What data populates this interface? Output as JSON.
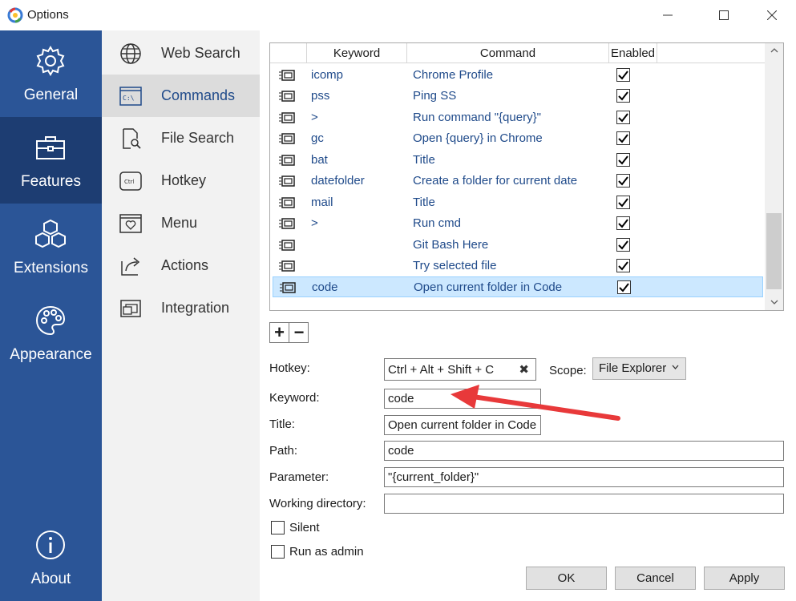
{
  "window": {
    "title": "Options"
  },
  "leftnav": {
    "items": [
      {
        "label": "General",
        "icon": "gear-icon"
      },
      {
        "label": "Features",
        "icon": "toolbox-icon"
      },
      {
        "label": "Extensions",
        "icon": "cubes-icon"
      },
      {
        "label": "Appearance",
        "icon": "palette-icon"
      },
      {
        "label": "About",
        "icon": "info-icon"
      }
    ]
  },
  "subnav": {
    "items": [
      {
        "label": "Web Search",
        "icon": "globe-icon"
      },
      {
        "label": "Commands",
        "icon": "terminal-icon"
      },
      {
        "label": "File Search",
        "icon": "file-search-icon"
      },
      {
        "label": "Hotkey",
        "icon": "ctrl-key-icon"
      },
      {
        "label": "Menu",
        "icon": "menu-icon"
      },
      {
        "label": "Actions",
        "icon": "share-arrow-icon"
      },
      {
        "label": "Integration",
        "icon": "window-icon"
      }
    ]
  },
  "grid": {
    "headers": {
      "keyword": "Keyword",
      "command": "Command",
      "enabled": "Enabled"
    },
    "rows": [
      {
        "keyword": "icomp",
        "command": "Chrome Profile",
        "enabled": true
      },
      {
        "keyword": "pss",
        "command": "Ping SS",
        "enabled": true
      },
      {
        "keyword": ">",
        "command": "Run command \"{query}\"",
        "enabled": true
      },
      {
        "keyword": "gc",
        "command": "Open {query} in Chrome",
        "enabled": true
      },
      {
        "keyword": "bat",
        "command": "Title",
        "enabled": true
      },
      {
        "keyword": "datefolder",
        "command": "Create a folder for current date",
        "enabled": true
      },
      {
        "keyword": "mail",
        "command": "Title",
        "enabled": true
      },
      {
        "keyword": ">",
        "command": "Run cmd",
        "enabled": true
      },
      {
        "keyword": "",
        "command": "Git Bash Here",
        "enabled": true
      },
      {
        "keyword": "",
        "command": "Try selected file",
        "enabled": true
      },
      {
        "keyword": "code",
        "command": "Open current folder in Code",
        "enabled": true,
        "selected": true
      }
    ]
  },
  "form": {
    "add_label": "+",
    "remove_label": "−",
    "hotkey_label": "Hotkey:",
    "hotkey_value": "Ctrl + Alt + Shift + C",
    "hotkey_clear": "✖",
    "scope_label": "Scope:",
    "scope_value": "File Explorer",
    "keyword_label": "Keyword:",
    "keyword_value": "code",
    "title_label": "Title:",
    "title_value": "Open current folder in Code",
    "path_label": "Path:",
    "path_value": "code",
    "parameter_label": "Parameter:",
    "parameter_value": "\"{current_folder}\"",
    "workdir_label": "Working directory:",
    "workdir_value": "",
    "silent_label": "Silent",
    "runadmin_label": "Run as admin"
  },
  "buttons": {
    "ok": "OK",
    "cancel": "Cancel",
    "apply": "Apply"
  },
  "colors": {
    "nav_bg": "#2b5597",
    "nav_active": "#1d3d72",
    "link": "#1f4a8a",
    "annotation_arrow": "#e8393a"
  }
}
